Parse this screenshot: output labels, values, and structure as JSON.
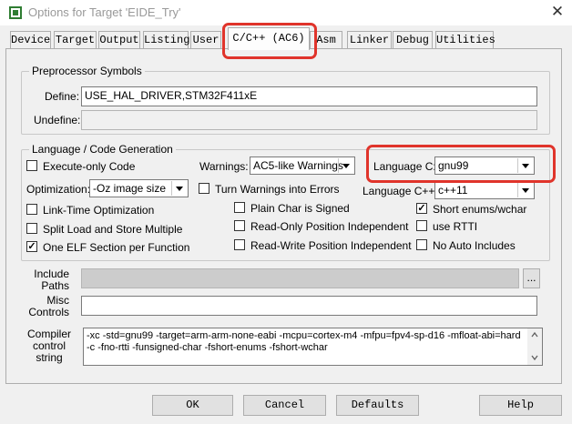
{
  "window": {
    "title": "Options for Target 'EIDE_Try'",
    "close_glyph": "✕",
    "app_icon": "keil-target-icon"
  },
  "tabs": [
    {
      "label": "Device",
      "active": false
    },
    {
      "label": "Target",
      "active": false
    },
    {
      "label": "Output",
      "active": false
    },
    {
      "label": "Listing",
      "active": false
    },
    {
      "label": "User",
      "active": false
    },
    {
      "label": "C/C++ (AC6)",
      "active": true
    },
    {
      "label": "Asm",
      "active": false
    },
    {
      "label": "Linker",
      "active": false
    },
    {
      "label": "Debug",
      "active": false
    },
    {
      "label": "Utilities",
      "active": false
    }
  ],
  "preprocessor": {
    "legend": "Preprocessor Symbols",
    "define_label": "Define:",
    "define_value": "USE_HAL_DRIVER,STM32F411xE",
    "undefine_label": "Undefine:",
    "undefine_value": ""
  },
  "language": {
    "legend": "Language / Code Generation",
    "execute_only": {
      "label": "Execute-only Code",
      "checked": false
    },
    "warnings_label": "Warnings:",
    "warnings_value": "AC5-like Warnings",
    "language_c_label": "Language C:",
    "language_c_value": "gnu99",
    "optimization_label": "Optimization:",
    "optimization_value": "-Oz image size",
    "turn_warnings": {
      "label": "Turn Warnings into Errors",
      "checked": false
    },
    "language_cpp_label": "Language C++:",
    "language_cpp_value": "c++11",
    "link_time": {
      "label": "Link-Time Optimization",
      "checked": false
    },
    "plain_char": {
      "label": "Plain Char is Signed",
      "checked": false
    },
    "short_enums": {
      "label": "Short enums/wchar",
      "checked": true
    },
    "split_load": {
      "label": "Split Load and Store Multiple",
      "checked": false
    },
    "ro_position": {
      "label": "Read-Only Position Independent",
      "checked": false
    },
    "use_rtti": {
      "label": "use RTTI",
      "checked": false
    },
    "one_elf": {
      "label": "One ELF Section per Function",
      "checked": true
    },
    "rw_position": {
      "label": "Read-Write Position Independent",
      "checked": false
    },
    "no_auto_includes": {
      "label": "No Auto Includes",
      "checked": false
    }
  },
  "include": {
    "label_line1": "Include",
    "label_line2": "Paths",
    "value": "",
    "browse_label": "..."
  },
  "misc": {
    "label_line1": "Misc",
    "label_line2": "Controls",
    "value": ""
  },
  "compiler": {
    "label_line1": "Compiler",
    "label_line2": "control",
    "label_line3": "string",
    "value": "-xc -std=gnu99 -target=arm-arm-none-eabi -mcpu=cortex-m4 -mfpu=fpv4-sp-d16 -mfloat-abi=hard -c -fno-rtti -funsigned-char -fshort-enums -fshort-wchar"
  },
  "buttons": {
    "ok": "OK",
    "cancel": "Cancel",
    "defaults": "Defaults",
    "help": "Help"
  },
  "colors": {
    "highlight": "#e0342b",
    "window_bg": "#f0f0f0"
  }
}
